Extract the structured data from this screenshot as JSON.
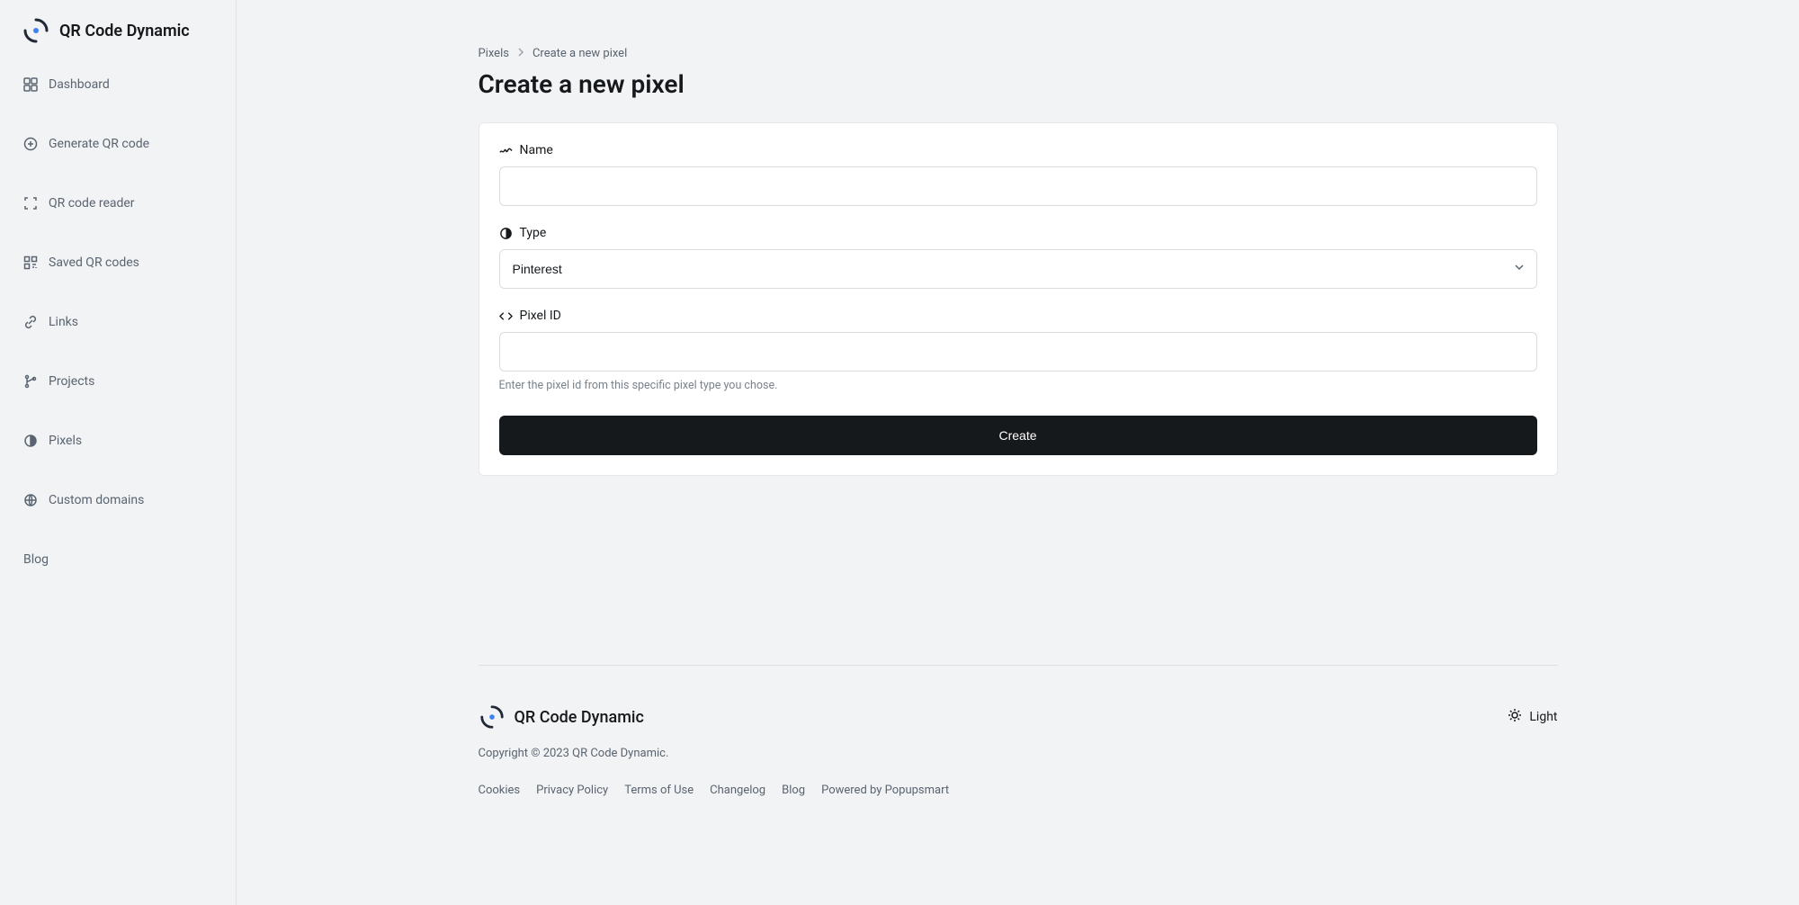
{
  "brand": {
    "name": "QR Code Dynamic"
  },
  "sidebar": {
    "items": [
      {
        "label": "Dashboard"
      },
      {
        "label": "Generate QR code"
      },
      {
        "label": "QR code reader"
      },
      {
        "label": "Saved QR codes"
      },
      {
        "label": "Links"
      },
      {
        "label": "Projects"
      },
      {
        "label": "Pixels"
      },
      {
        "label": "Custom domains"
      },
      {
        "label": "Blog"
      }
    ]
  },
  "breadcrumb": {
    "parent": "Pixels",
    "current": "Create a new pixel"
  },
  "page": {
    "title": "Create a new pixel"
  },
  "form": {
    "name_label": "Name",
    "name_value": "",
    "type_label": "Type",
    "type_value": "Pinterest",
    "pixel_id_label": "Pixel ID",
    "pixel_id_value": "",
    "pixel_id_help": "Enter the pixel id from this specific pixel type you chose.",
    "submit_label": "Create"
  },
  "footer": {
    "theme_label": "Light",
    "copyright": "Copyright © 2023 QR Code Dynamic.",
    "links": [
      "Cookies",
      "Privacy Policy",
      "Terms of Use",
      "Changelog",
      "Blog",
      "Powered by Popupsmart"
    ]
  }
}
